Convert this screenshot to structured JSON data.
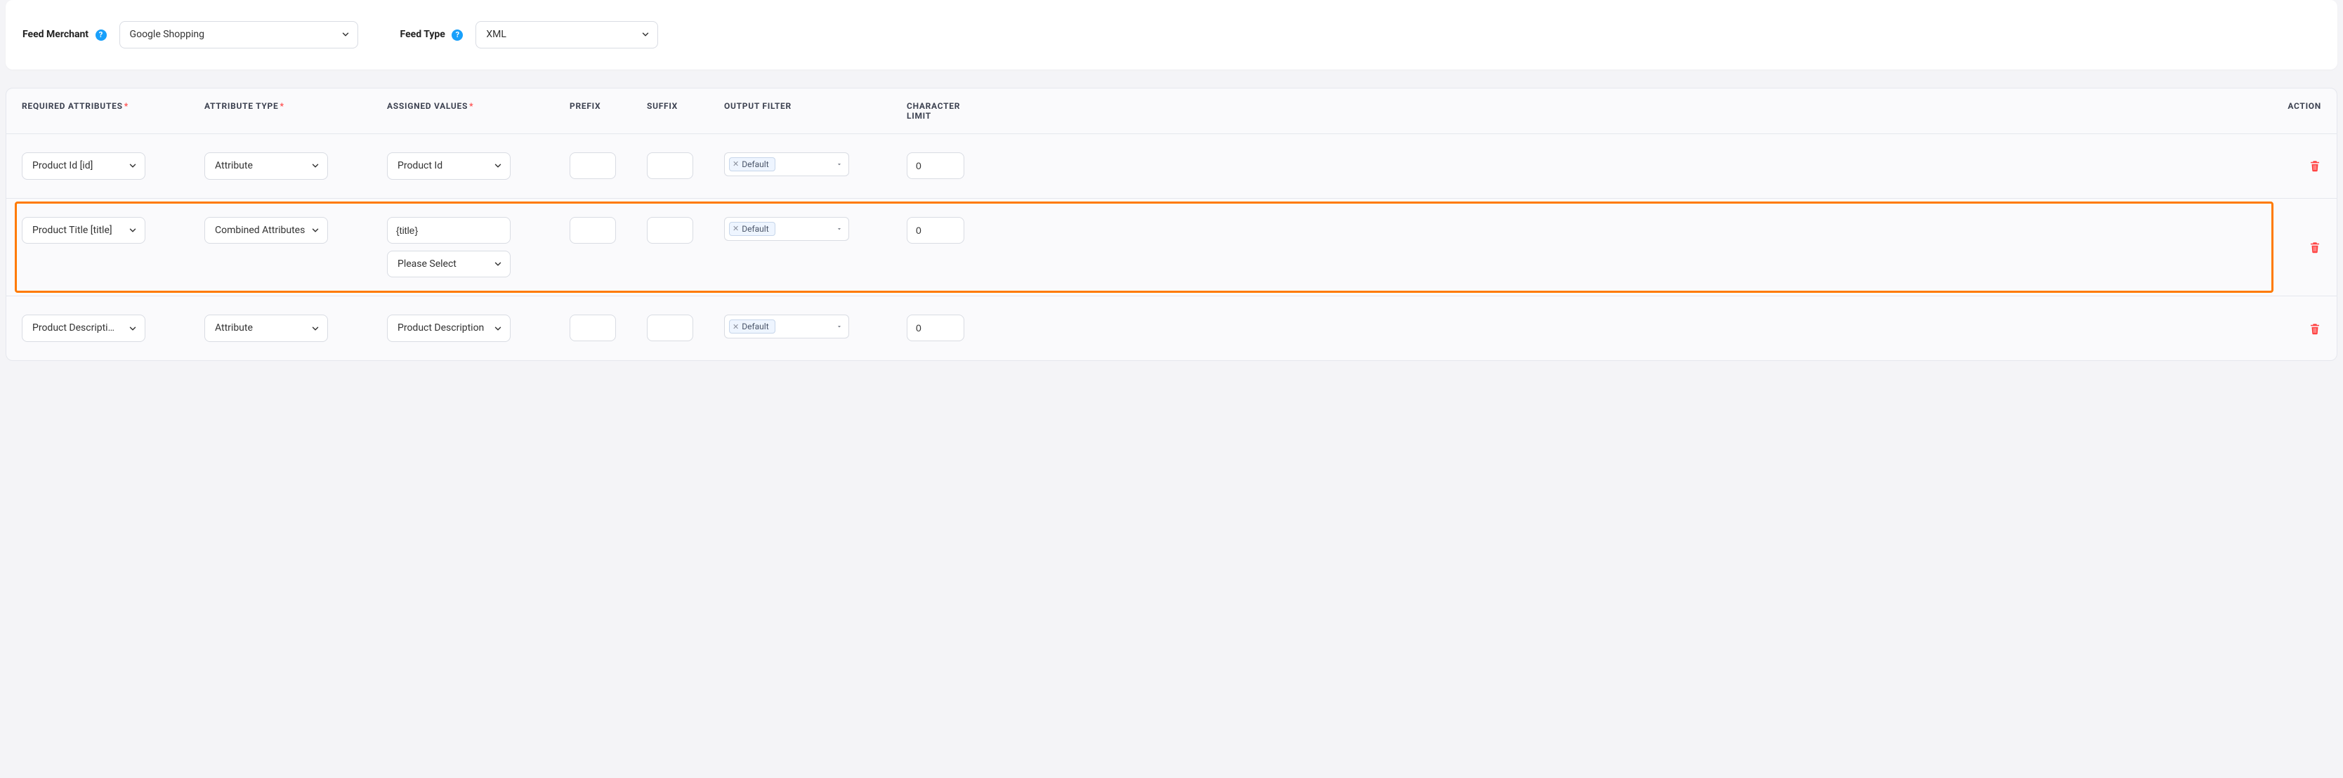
{
  "feed_panel": {
    "merchant_label": "Feed Merchant",
    "merchant_value": "Google Shopping",
    "type_label": "Feed Type",
    "type_value": "XML"
  },
  "columns": {
    "required": "REQUIRED ATTRIBUTES",
    "attr_type": "ATTRIBUTE TYPE",
    "assigned": "ASSIGNED VALUES",
    "prefix": "PREFIX",
    "suffix": "SUFFIX",
    "output_filter": "OUTPUT FILTER",
    "char_limit": "CHARACTER LIMIT",
    "action": "ACTION"
  },
  "common": {
    "output_filter_tag": "Default",
    "please_select": "Please Select"
  },
  "rows": [
    {
      "required": "Product Id [id]",
      "attr_type": "Attribute",
      "assigned_mode": "select",
      "assigned_select": "Product Id",
      "char_limit": "0",
      "highlight": false
    },
    {
      "required": "Product Title [title]",
      "attr_type": "Combined Attributes",
      "assigned_mode": "combined",
      "assigned_text": "{title}",
      "char_limit": "0",
      "highlight": true
    },
    {
      "required": "Product Description [description]",
      "attr_type": "Attribute",
      "assigned_mode": "select",
      "assigned_select": "Product Description",
      "char_limit": "0",
      "highlight": false
    }
  ]
}
